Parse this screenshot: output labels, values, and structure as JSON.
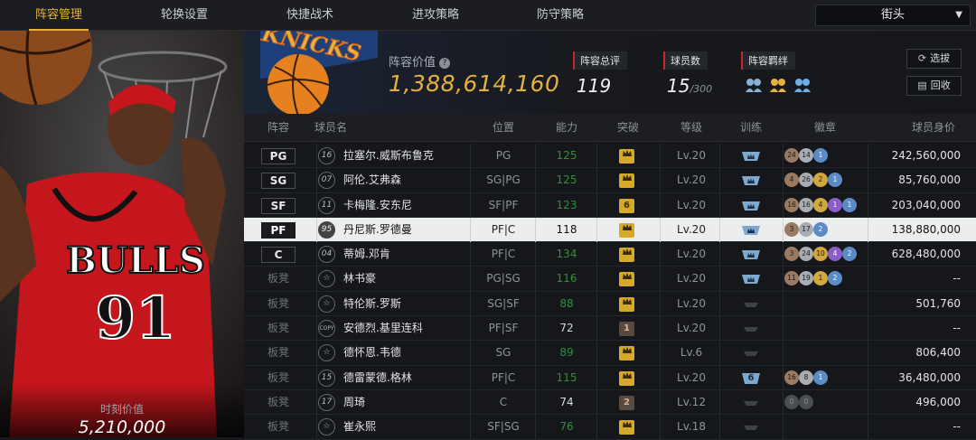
{
  "nav": {
    "tabs": [
      "阵容管理",
      "轮换设置",
      "快捷战术",
      "进攻策略",
      "防守策略"
    ],
    "active_tab": 0,
    "mode": "街头"
  },
  "featured": {
    "moment_value_label": "时刻价值",
    "moment_value": "5,210,000",
    "jersey_team": "BULLS",
    "jersey_number": "91"
  },
  "header": {
    "team_logo_text": "KNICKS",
    "team_value_label": "阵容价值",
    "team_value": "1,388,614,160",
    "overall_label": "阵容总评",
    "overall_value": "119",
    "players_label": "球员数",
    "players_value": "15",
    "players_max": "/300",
    "bonds_label": "阵容羁绊",
    "bonds_icons": [
      "bond-icon-1",
      "bond-icon-2",
      "bond-icon-3"
    ],
    "btn_select": "选拔",
    "btn_recycle": "回收"
  },
  "columns": [
    "阵容",
    "球员名",
    "位置",
    "能力",
    "突破",
    "等级",
    "训练",
    "徽章",
    "球员身价"
  ],
  "players": [
    {
      "slot": "PG",
      "starter": true,
      "jersey": "16",
      "name": "拉塞尔.威斯布鲁克",
      "pos": "PG",
      "ability": "125",
      "ab_boost": true,
      "breakthrough": "crown",
      "level": "Lv.20",
      "training": "crown",
      "badges": [
        [
          "24",
          "bronze"
        ],
        [
          "14",
          "silver"
        ],
        [
          "1",
          "blue"
        ]
      ],
      "salary": "242,560,000"
    },
    {
      "slot": "SG",
      "starter": true,
      "jersey": "07",
      "name": "阿伦.艾弗森",
      "pos": "SG|PG",
      "ability": "125",
      "ab_boost": true,
      "breakthrough": "crown",
      "level": "Lv.20",
      "training": "crown",
      "badges": [
        [
          "4",
          "bronze"
        ],
        [
          "26",
          "silver"
        ],
        [
          "2",
          "gold"
        ],
        [
          "1",
          "blue"
        ]
      ],
      "salary": "85,760,000"
    },
    {
      "slot": "SF",
      "starter": true,
      "jersey": "11",
      "name": "卡梅隆.安东尼",
      "pos": "SF|PF",
      "ability": "123",
      "ab_boost": true,
      "breakthrough": "6",
      "level": "Lv.20",
      "training": "crown",
      "badges": [
        [
          "16",
          "bronze"
        ],
        [
          "16",
          "silver"
        ],
        [
          "4",
          "gold"
        ],
        [
          "1",
          "purple"
        ],
        [
          "1",
          "blue"
        ]
      ],
      "salary": "203,040,000"
    },
    {
      "slot": "PF",
      "starter": true,
      "selected": true,
      "jersey": "95",
      "name": "丹尼斯.罗德曼",
      "pos": "PF|C",
      "ability": "118",
      "ab_boost": false,
      "breakthrough": "crown",
      "level": "Lv.20",
      "training": "crown",
      "badges": [
        [
          "3",
          "bronze"
        ],
        [
          "17",
          "silver"
        ],
        [
          "2",
          "blue"
        ]
      ],
      "salary": "138,880,000"
    },
    {
      "slot": "C",
      "starter": true,
      "jersey": "04",
      "name": "蒂姆.邓肯",
      "pos": "PF|C",
      "ability": "134",
      "ab_boost": true,
      "breakthrough": "crown",
      "level": "Lv.20",
      "training": "crown",
      "badges": [
        [
          "3",
          "bronze"
        ],
        [
          "24",
          "silver"
        ],
        [
          "10",
          "gold"
        ],
        [
          "4",
          "purple"
        ],
        [
          "2",
          "blue"
        ]
      ],
      "salary": "628,480,000"
    },
    {
      "slot": "板凳",
      "starter": false,
      "jersey": "star",
      "name": "林书豪",
      "pos": "PG|SG",
      "ability": "116",
      "ab_boost": true,
      "breakthrough": "crown",
      "level": "Lv.20",
      "training": "crown",
      "badges": [
        [
          "11",
          "bronze"
        ],
        [
          "19",
          "silver"
        ],
        [
          "1",
          "gold"
        ],
        [
          "2",
          "blue"
        ]
      ],
      "salary": "--"
    },
    {
      "slot": "板凳",
      "starter": false,
      "jersey": "star",
      "name": "特伦斯.罗斯",
      "pos": "SG|SF",
      "ability": "88",
      "ab_boost": true,
      "breakthrough": "crown",
      "level": "Lv.20",
      "training": "none",
      "badges": [],
      "salary": "501,760"
    },
    {
      "slot": "板凳",
      "starter": false,
      "jersey": "COPY",
      "name": "安德烈.基里连科",
      "pos": "PF|SF",
      "ability": "72",
      "ab_boost": false,
      "breakthrough": "1",
      "level": "Lv.20",
      "training": "none",
      "badges": [],
      "salary": "--"
    },
    {
      "slot": "板凳",
      "starter": false,
      "jersey": "star",
      "name": "德怀恩.韦德",
      "pos": "SG",
      "ability": "89",
      "ab_boost": true,
      "breakthrough": "crown",
      "level": "Lv.6",
      "training": "none",
      "badges": [],
      "salary": "806,400"
    },
    {
      "slot": "板凳",
      "starter": false,
      "jersey": "15",
      "name": "德雷蒙德.格林",
      "pos": "PF|C",
      "ability": "115",
      "ab_boost": true,
      "breakthrough": "crown",
      "level": "Lv.20",
      "training": "6",
      "badges": [
        [
          "16",
          "bronze"
        ],
        [
          "8",
          "silver"
        ],
        [
          "1",
          "blue"
        ]
      ],
      "salary": "36,480,000"
    },
    {
      "slot": "板凳",
      "starter": false,
      "jersey": "17",
      "name": "周琦",
      "pos": "C",
      "ability": "74",
      "ab_boost": false,
      "breakthrough": "2",
      "level": "Lv.12",
      "training": "none",
      "badges": [
        [
          "0",
          "grey"
        ],
        [
          "0",
          "grey"
        ]
      ],
      "salary": "496,000"
    },
    {
      "slot": "板凳",
      "starter": false,
      "jersey": "star",
      "name": "崔永熙",
      "pos": "SF|SG",
      "ability": "76",
      "ab_boost": true,
      "breakthrough": "crown",
      "level": "Lv.18",
      "training": "none",
      "badges": [],
      "salary": "--"
    }
  ]
}
